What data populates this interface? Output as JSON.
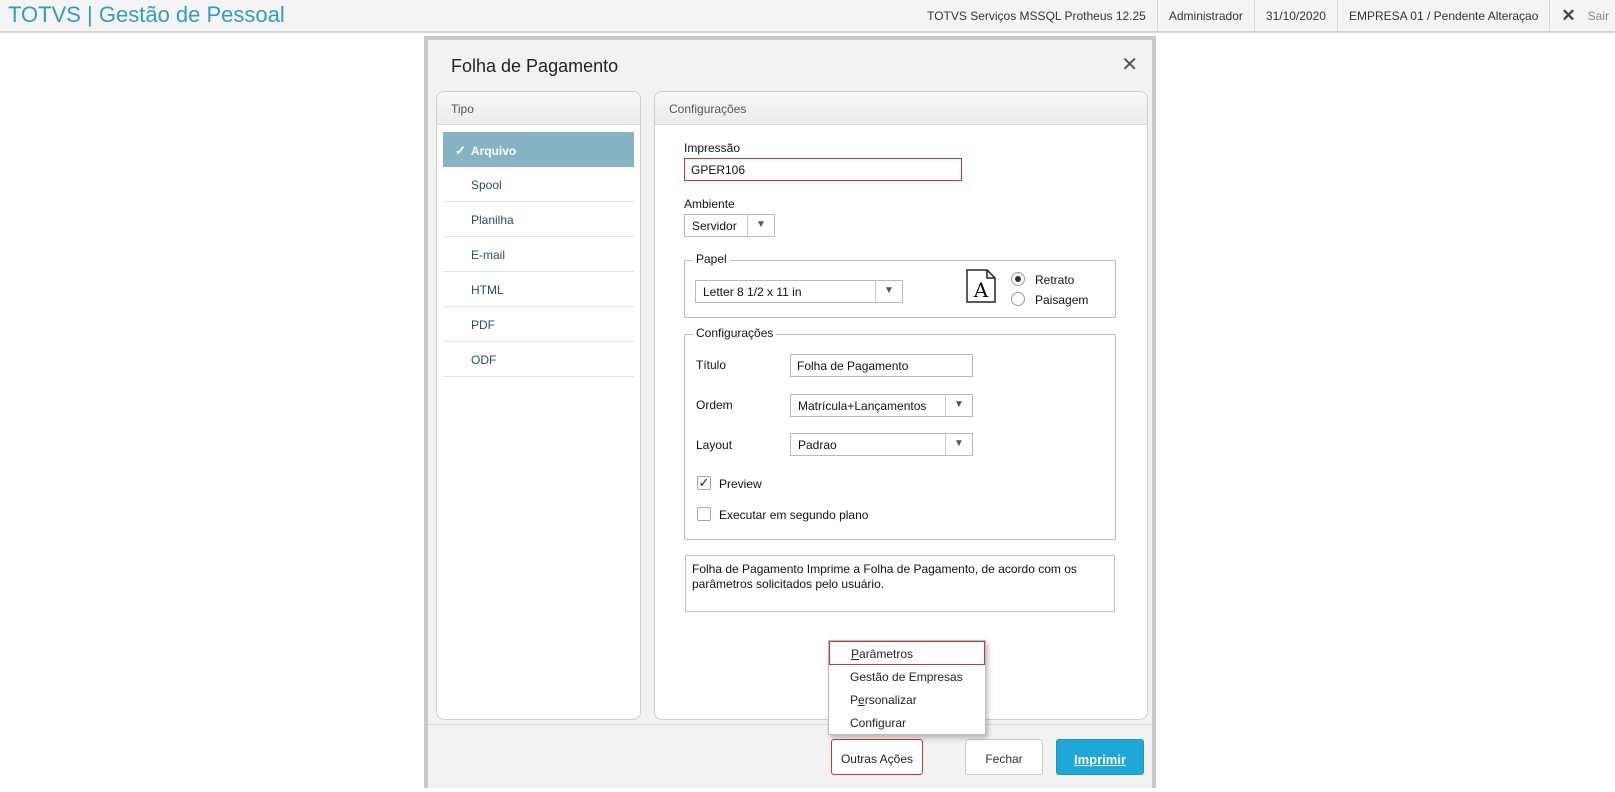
{
  "topbar": {
    "title": "TOTVS | Gestão de Pessoal",
    "environment": "TOTVS Serviços MSSQL Protheus 12.25",
    "user": "Administrador",
    "date": "31/10/2020",
    "company": "EMPRESA 01 / Pendente Alteraçao",
    "exit_label": "Sair"
  },
  "dialog": {
    "title": "Folha de Pagamento",
    "tipo": {
      "header": "Tipo",
      "items": [
        {
          "label": "Arquivo",
          "active": true
        },
        {
          "label": "Spool"
        },
        {
          "label": "Planilha"
        },
        {
          "label": "E-mail"
        },
        {
          "label": "HTML"
        },
        {
          "label": "PDF"
        },
        {
          "label": "ODF"
        }
      ]
    },
    "config": {
      "header": "Configurações",
      "impressao_label": "Impressão",
      "impressao_value": "GPER106",
      "ambiente_label": "Ambiente",
      "ambiente_value": "Servidor",
      "papel": {
        "title": "Papel",
        "paper_value": "Letter 8 1/2 x 11 in",
        "orientation_options": [
          "Retrato",
          "Paisagem"
        ],
        "orientation_selected": "Retrato",
        "icon_letter": "A"
      },
      "configuracoes": {
        "title": "Configurações",
        "titulo_label": "Título",
        "titulo_value": "Folha de Pagamento",
        "ordem_label": "Ordem",
        "ordem_value": "Matrícula+Lançamentos",
        "layout_label": "Layout",
        "layout_value": "Padrao",
        "preview_label": "Preview",
        "preview_checked": true,
        "background_label": "Executar em segundo plano",
        "background_checked": false
      },
      "description": "Folha de Pagamento Imprime a Folha de Pagamento, de acordo com os parâmetros solicitados pelo usuário."
    },
    "menu": {
      "items": [
        {
          "pre": "",
          "ul": "P",
          "post": "arâmetros"
        },
        {
          "pre": "",
          "ul": "",
          "post": "Gestão de Empresas"
        },
        {
          "pre": "P",
          "ul": "e",
          "post": "rsonalizar"
        },
        {
          "pre": "",
          "ul": "",
          "post": "Configurar"
        }
      ]
    },
    "buttons": {
      "outras_acoes": "Outras Ações",
      "fechar": "Fechar",
      "imprimir": "Imprimir"
    }
  },
  "colors": {
    "brand": "#2d9cc7",
    "active_item": "#87b4c4",
    "primary_button": "#1ea7d8",
    "highlight_border": "#d9303a"
  }
}
